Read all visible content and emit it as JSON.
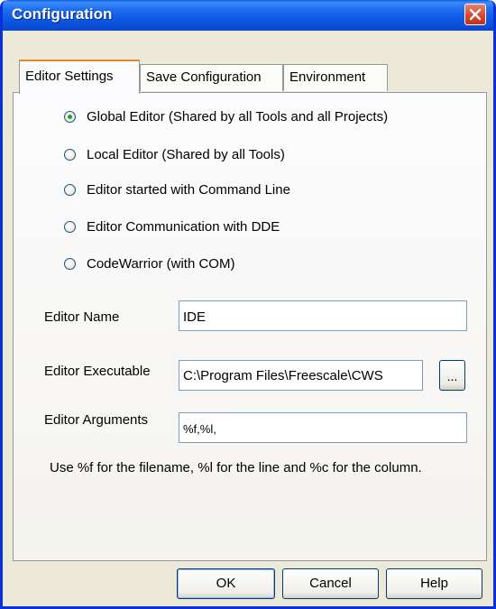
{
  "window": {
    "title": "Configuration"
  },
  "tabs": [
    {
      "label": "Editor Settings",
      "active": true
    },
    {
      "label": "Save Configuration",
      "active": false
    },
    {
      "label": "Environment",
      "active": false
    }
  ],
  "editor_options": [
    {
      "label": "Global Editor (Shared by all Tools and all Projects)",
      "checked": true
    },
    {
      "label": "Local Editor (Shared by all Tools)",
      "checked": false
    },
    {
      "label": "Editor started with Command Line",
      "checked": false
    },
    {
      "label": "Editor Communication with DDE",
      "checked": false
    },
    {
      "label": "CodeWarrior (with COM)",
      "checked": false
    }
  ],
  "fields": {
    "editor_name": {
      "label": "Editor Name",
      "value": "IDE"
    },
    "editor_executable": {
      "label": "Editor Executable",
      "value": "C:\\Program Files\\Freescale\\CWS"
    },
    "editor_arguments": {
      "label": "Editor Arguments",
      "value": "%f,%l,"
    }
  },
  "browse_label": "...",
  "hint": "Use %f for the filename, %l for the line and %c for the column.",
  "buttons": {
    "ok": "OK",
    "cancel": "Cancel",
    "help": "Help"
  }
}
